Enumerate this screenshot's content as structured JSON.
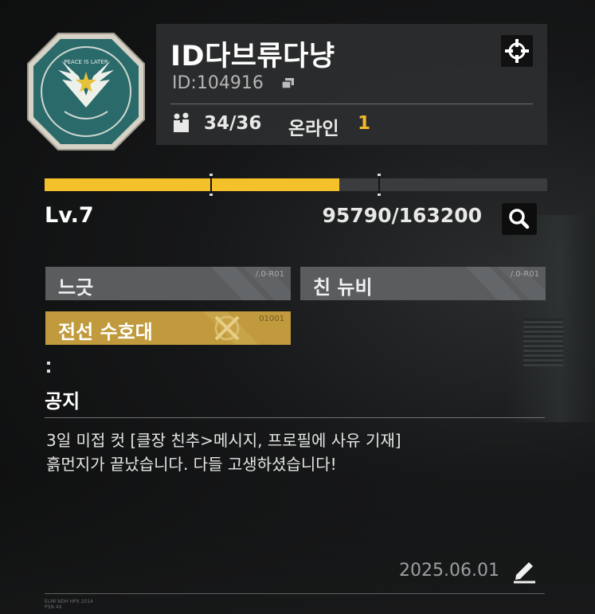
{
  "guild": {
    "name": "ID다브류다냥",
    "id": "ID:104916",
    "members": "34/36",
    "online_label": "온라인",
    "online_count": "1"
  },
  "level": {
    "label": "Lv.7",
    "xp": "95790/163200",
    "progress": 0.587
  },
  "tags": [
    {
      "label": "느긋",
      "code": "/.0-R01"
    },
    {
      "label": "친 뉴비",
      "code": "/.0-R01"
    },
    {
      "label": "전선 수호대",
      "code": "01001"
    }
  ],
  "badge": {
    "text": "PEACE IS LATER"
  },
  "notice": {
    "title": "공지",
    "lines": [
      "3일 미접 컷 [클장 친추>메시지, 프로필에 사유 기재]",
      "흙먼지가 끝났습니다. 다들 고생하셨습니다!"
    ],
    "date": "2025.06.01"
  },
  "footer": {
    "lines": [
      "ELMI NDH HPX 2014",
      "PSN 4X"
    ]
  },
  "icons": {
    "copy": "copy-icon",
    "members": "members-icon",
    "target": "crosshair-icon",
    "search": "search-icon",
    "edit": "pencil-icon"
  },
  "colors": {
    "accent": "#f5c12a",
    "tag_gray": "#5a5c5e",
    "tag_gold": "#c09a3c",
    "panel": "#2d2f30"
  }
}
